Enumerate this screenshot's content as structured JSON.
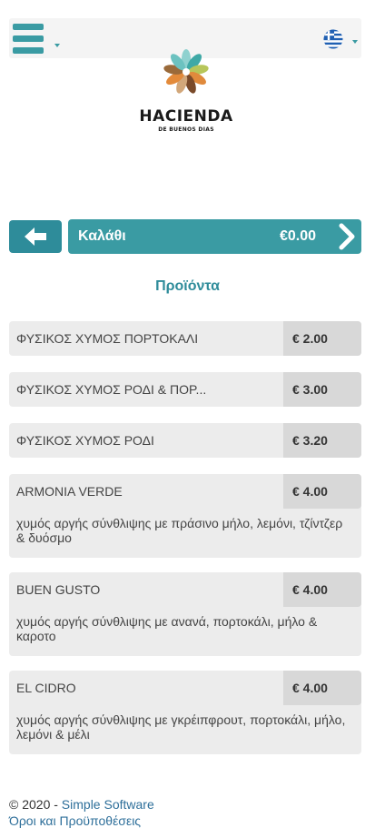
{
  "header": {
    "menu_icon": "hamburger-menu-icon",
    "language_icon": "greek-flag-icon"
  },
  "logo": {
    "title": "HACIENDA",
    "subtitle": "DE BUENOS DIAS"
  },
  "cart": {
    "label": "Καλάθι",
    "total": "€0.00"
  },
  "section_title": "Προϊόντα",
  "products": [
    {
      "name": "ΦΥΣΙΚΟΣ ΧΥΜΟΣ ΠΟΡΤΟΚΑΛΙ",
      "price": "€ 2.00",
      "description": ""
    },
    {
      "name": "ΦΥΣΙΚΟΣ ΧΥΜΟΣ ΡΟΔΙ & ΠΟΡ...",
      "price": "€ 3.00",
      "description": ""
    },
    {
      "name": "ΦΥΣΙΚΟΣ ΧΥΜΟΣ ΡΟΔΙ",
      "price": "€ 3.20",
      "description": ""
    },
    {
      "name": "ARMONIA VERDE",
      "price": "€ 4.00",
      "description": "χυμός αργής σύνθλιψης με πράσινο μήλο, λεμόνι, τζίντζερ & δυόσμο"
    },
    {
      "name": "BUEN GUSTO",
      "price": "€ 4.00",
      "description": "χυμός αργής σύνθλιψης με ανανά, πορτοκάλι, μήλο & καροτο"
    },
    {
      "name": "EL CIDRO",
      "price": "€ 4.00",
      "description": "χυμός αργής σύνθλιψης με γκρέιπφρουτ, πορτοκάλι, μήλο, λεμόνι & μέλι"
    }
  ],
  "footer": {
    "copyright": "© 2020 - ",
    "company_link": "Simple Software",
    "terms_link": "Όροι και Προϋποθέσεις"
  },
  "colors": {
    "accent": "#3a9ba3",
    "accent_dark": "#2e8c9a"
  }
}
